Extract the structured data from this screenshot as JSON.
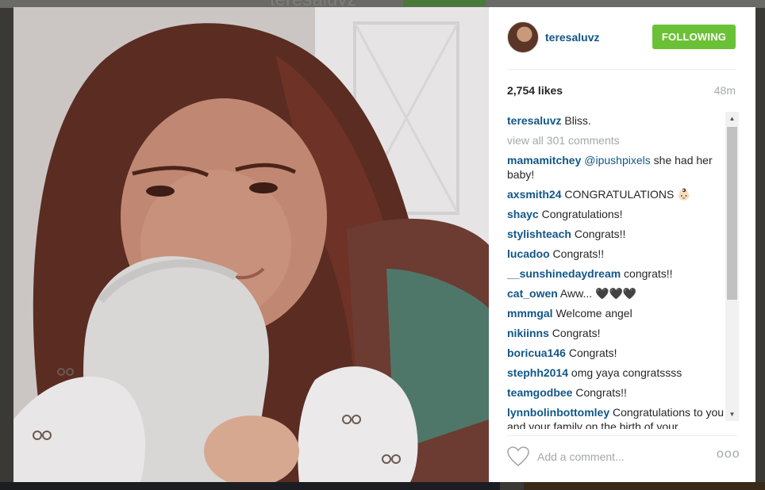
{
  "background_page": {
    "username": "teresaluvz"
  },
  "post": {
    "photo_icon": "post-photo",
    "author": {
      "username": "teresaluvz",
      "avatar": "avatar-icon"
    },
    "follow_button": "FOLLOWING",
    "likes": "2,754 likes",
    "time": "48m",
    "caption": {
      "user": "teresaluvz",
      "text": "Bliss."
    },
    "view_all": "view all 301 comments",
    "comments": [
      {
        "user": "mamamitchey",
        "mention": "@ipushpixels",
        "text": " she had her baby!"
      },
      {
        "user": "axsmith24",
        "text": " CONGRATULATIONS 👶🏻"
      },
      {
        "user": "shayc",
        "text": " Congratulations!"
      },
      {
        "user": "stylishteach",
        "text": " Congrats!!"
      },
      {
        "user": "lucadoo",
        "text": " Congrats!!"
      },
      {
        "user": "__sunshinedaydream",
        "text": " congrats!!"
      },
      {
        "user": "cat_owen",
        "text": " Aww... 🖤🖤🖤"
      },
      {
        "user": "mmmgal",
        "text": " Welcome angel"
      },
      {
        "user": "nikiinns",
        "text": " Congrats!"
      },
      {
        "user": "boricua146",
        "text": " Congrats!"
      },
      {
        "user": "stephh2014",
        "text": " omg yaya congratssss"
      },
      {
        "user": "teamgodbee",
        "text": " Congrats!!"
      },
      {
        "user": "lynnbolinbottomley",
        "text": " Congratulations to you and your family on the birth of your"
      }
    ],
    "comment_placeholder": "Add a comment...",
    "more_label": "ooo",
    "icons": {
      "heart": "heart-icon",
      "more": "more-options-icon",
      "scroll_up": "scroll-up-arrow-icon",
      "scroll_down": "scroll-down-arrow-icon"
    },
    "colors": {
      "username": "#125688",
      "follow_button_bg": "#6bc136",
      "muted_text": "#a5a7aa"
    }
  }
}
